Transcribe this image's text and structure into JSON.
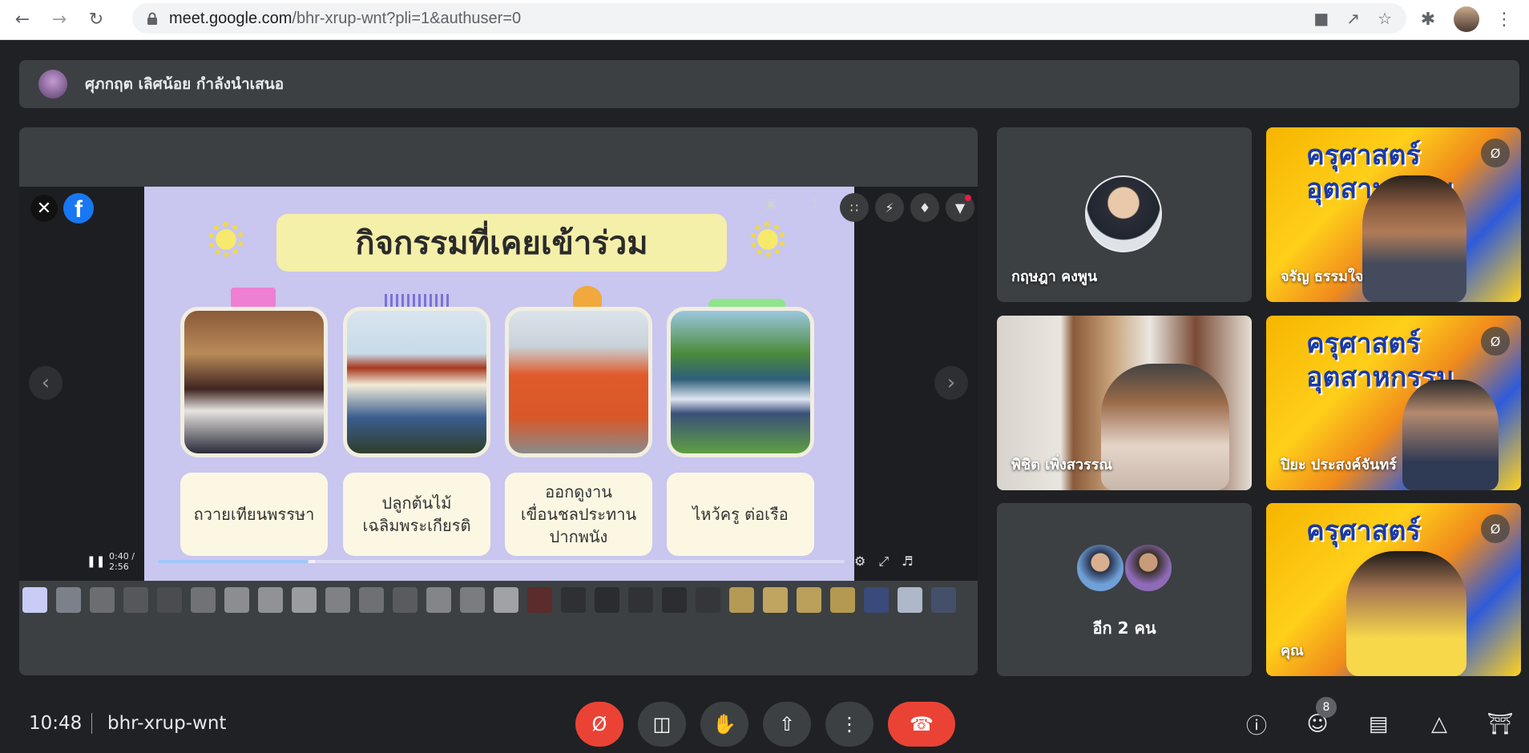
{
  "browser": {
    "url_host": "meet.google.com",
    "url_path": "/bhr-xrup-wnt?pli=1&authuser=0"
  },
  "banner": {
    "presenter_text": "ศุภกฤต เลิศน้อย กำลังนำเสนอ"
  },
  "presentation": {
    "slide_title": "กิจกรรมที่เคยเข้าร่วม",
    "captions": [
      "ถวายเทียนพรรษา",
      "ปลูกต้นไม้\nเฉลิมพระเกียรติ",
      "ออกดูงาน\nเขื่อนชลประทาน\nปากพนัง",
      "ไหว้ครู ต่อเรือ"
    ],
    "video_time": "0:40 / 2:56",
    "progress": 0.22,
    "buffered": 0.23
  },
  "participants": [
    {
      "name": "กฤษฎา คงพูน",
      "muted": false
    },
    {
      "name": "จรัญ ธรรมใจ",
      "muted": true,
      "banner": "ครุศาสตร์\nอุตสาหกรรม"
    },
    {
      "name": "พิชิต เพิ่งสวรรณ",
      "muted": false
    },
    {
      "name": "ปิยะ ประสงค์จันทร์",
      "muted": true,
      "banner": "ครุศาสตร์\nอุตสาหกรรม"
    },
    {
      "name": "คุณ",
      "muted": true,
      "banner": "ครุศาสตร์"
    }
  ],
  "others": {
    "label": "อีก 2 คน"
  },
  "bottom_bar": {
    "clock": "10:48",
    "meeting_code": "bhr-xrup-wnt",
    "people_count": "8"
  },
  "colors": {
    "background": "#202124",
    "tile": "#3c4043",
    "end_call": "#ea4335",
    "facebook_blue": "#1877f2"
  }
}
